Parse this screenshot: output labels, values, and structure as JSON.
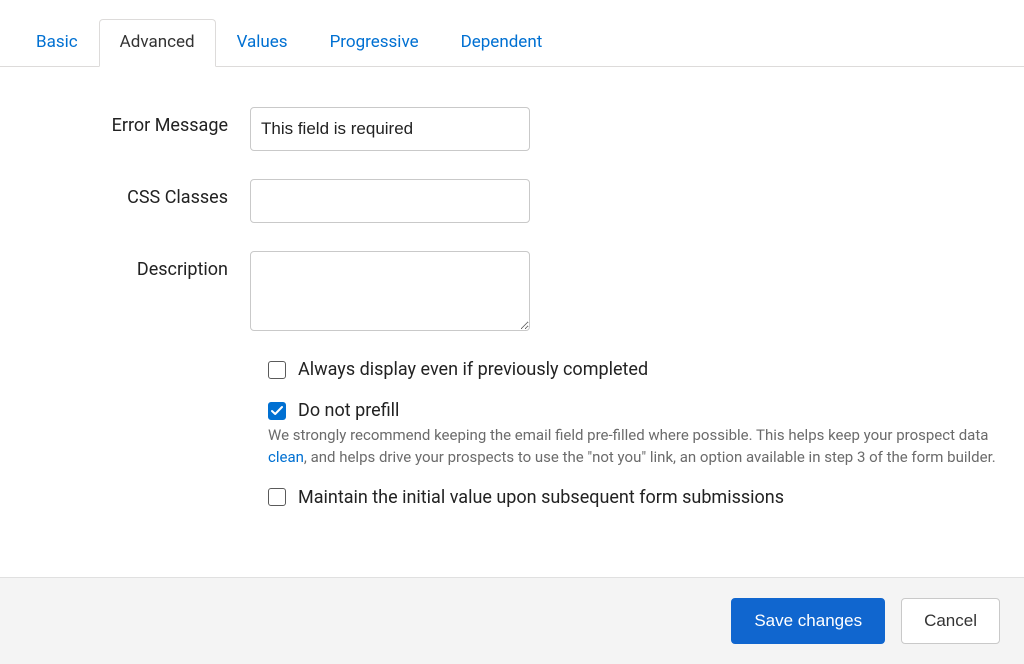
{
  "tabs": {
    "basic": "Basic",
    "advanced": "Advanced",
    "values": "Values",
    "progressive": "Progressive",
    "dependent": "Dependent"
  },
  "fields": {
    "error_message": {
      "label": "Error Message",
      "value": "This field is required"
    },
    "css_classes": {
      "label": "CSS Classes",
      "value": ""
    },
    "description": {
      "label": "Description",
      "value": ""
    }
  },
  "checkboxes": {
    "always_display": {
      "label": "Always display even if previously completed",
      "checked": false
    },
    "do_not_prefill": {
      "label": "Do not prefill",
      "checked": true
    },
    "maintain_initial": {
      "label": "Maintain the initial value upon subsequent form submissions",
      "checked": false
    }
  },
  "help": {
    "prefill_note_a": "We strongly recommend keeping the email field pre-filled where possible. This helps keep your prospect data ",
    "prefill_link": "clean",
    "prefill_note_b": ", and helps drive your prospects to use the \"not you\" link, an option available in step 3 of the form builder."
  },
  "buttons": {
    "save": "Save changes",
    "cancel": "Cancel"
  }
}
